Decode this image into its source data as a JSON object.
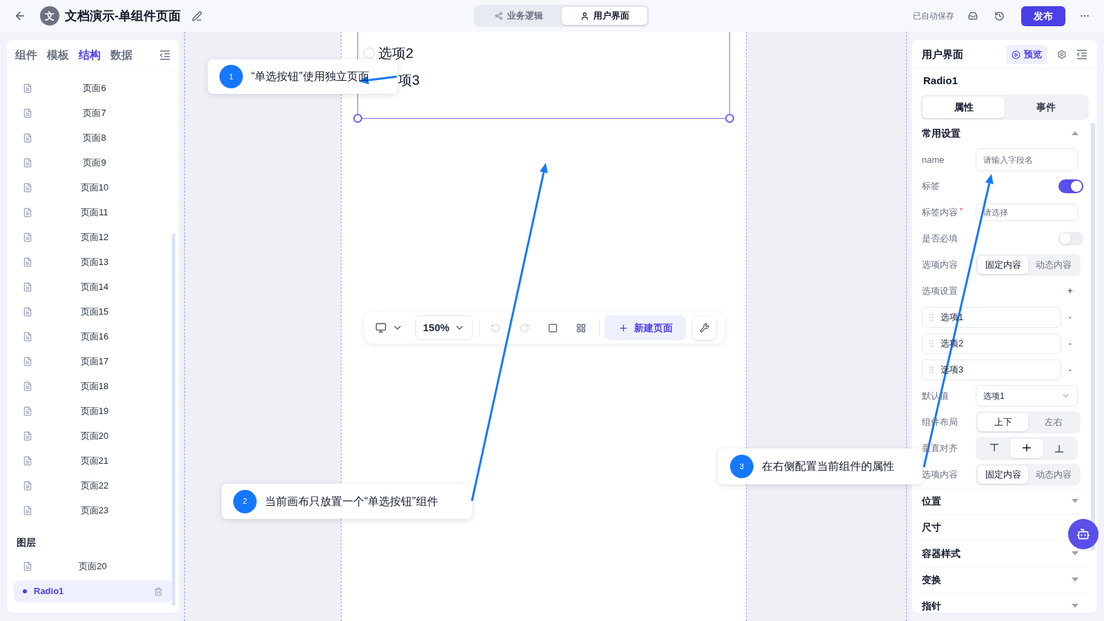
{
  "header": {
    "title": "文档演示-单组件页面",
    "avatar": "文",
    "mode_tabs": [
      {
        "label": "业务逻辑",
        "kind": "logic",
        "selected": false
      },
      {
        "label": "用户界面",
        "kind": "ui",
        "selected": true
      }
    ],
    "autosave": "已自动保存",
    "publish": "发布"
  },
  "left_panel": {
    "tabs": [
      {
        "label": "组件",
        "selected": false
      },
      {
        "label": "模板",
        "selected": false
      },
      {
        "label": "结构",
        "selected": true
      },
      {
        "label": "数据",
        "selected": false
      }
    ],
    "pages": [
      "页面6",
      "页面7",
      "页面8",
      "页面9",
      "页面10",
      "页面11",
      "页面12",
      "页面13",
      "页面14",
      "页面15",
      "页面16",
      "页面17",
      "页面18",
      "页面19",
      "页面20",
      "页面21",
      "页面22",
      "页面23"
    ],
    "layers_title": "图层",
    "layers": [
      {
        "label": "页面20",
        "kind": "page",
        "selected": false
      },
      {
        "label": "Radio1",
        "kind": "component",
        "selected": true
      }
    ]
  },
  "canvas": {
    "options": [
      {
        "label": "选项2",
        "kind": "radio",
        "checked": false
      },
      {
        "label": "项3",
        "kind": "covered"
      }
    ],
    "toolbar": {
      "zoom": "150%",
      "new_page": "新建页面"
    }
  },
  "right_panel": {
    "title": "用户界面",
    "preview": "预览",
    "component": "Radio1",
    "tabs": [
      {
        "label": "属性",
        "selected": true
      },
      {
        "label": "事件",
        "selected": false
      }
    ],
    "common_section": {
      "title": "常用设置",
      "expanded": true
    },
    "rows": [
      {
        "kind": "input",
        "label": "name",
        "placeholder": "请输入字段名"
      },
      {
        "kind": "toggle",
        "label": "标签",
        "on": true
      },
      {
        "kind": "input",
        "label": "标签内容",
        "required_mark": "*",
        "placeholder": "请选择"
      },
      {
        "kind": "toggle",
        "label": "是否必填",
        "on": false
      },
      {
        "kind": "segmented",
        "label": "选项内容",
        "options": [
          {
            "label": "固定内容",
            "selected": true
          },
          {
            "label": "动态内容",
            "selected": false
          }
        ]
      },
      {
        "kind": "adder",
        "label": "选项设置",
        "add": "+"
      },
      {
        "kind": "item",
        "label": "选项1",
        "remove": "-"
      },
      {
        "kind": "item",
        "label": "选项2",
        "remove": "-"
      },
      {
        "kind": "item",
        "label": "选项3",
        "remove": "-"
      },
      {
        "kind": "select",
        "label": "默认值",
        "value": "选项1"
      },
      {
        "kind": "segmented",
        "label": "组件布局",
        "options": [
          {
            "label": "上下",
            "selected": true
          },
          {
            "label": "左右",
            "selected": false
          }
        ]
      },
      {
        "kind": "align",
        "label": "垂直对齐",
        "options": [
          {
            "kind": "top",
            "selected": false
          },
          {
            "kind": "middle",
            "selected": true
          },
          {
            "kind": "bottom",
            "selected": false
          }
        ]
      },
      {
        "kind": "segmented",
        "label": "选项内容",
        "options": [
          {
            "label": "固定内容",
            "selected": true
          },
          {
            "label": "动态内容",
            "selected": false
          }
        ]
      }
    ],
    "sections": [
      {
        "title": "位置",
        "expanded": false
      },
      {
        "title": "尺寸"
      },
      {
        "title": "容器样式",
        "expanded": false
      },
      {
        "title": "变换",
        "expanded": false
      },
      {
        "title": "指针",
        "expanded": false
      }
    ]
  },
  "callouts": [
    {
      "number": "1",
      "text": "“单选按钮”使用独立页面"
    },
    {
      "number": "2",
      "text": "当前画布只放置一个“单选按钮”组件"
    },
    {
      "number": "3",
      "text": "在右侧配置当前组件的属性"
    }
  ]
}
